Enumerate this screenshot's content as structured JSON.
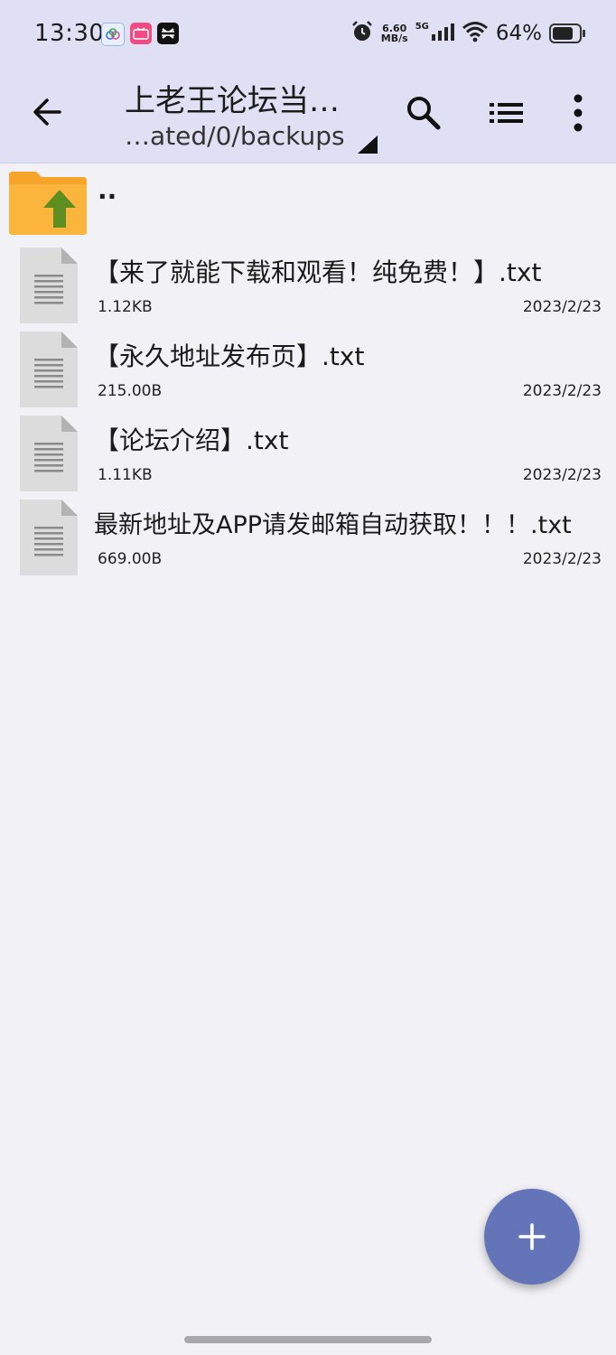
{
  "status_bar": {
    "time": "13:30",
    "net_speed_value": "6.60",
    "net_speed_unit": "MB/s",
    "signal_label": "5G",
    "battery": "64%"
  },
  "toolbar": {
    "title": "上老王论坛当…",
    "path": "…ated/0/backups"
  },
  "parent_dir": "..",
  "files": [
    {
      "name": "【来了就能下载和观看！纯免费！】.txt",
      "size": "1.12KB",
      "date": "2023/2/23"
    },
    {
      "name": "【永久地址发布页】.txt",
      "size": "215.00B",
      "date": "2023/2/23"
    },
    {
      "name": "【论坛介绍】.txt",
      "size": "1.11KB",
      "date": "2023/2/23"
    },
    {
      "name": "最新地址及APP请发邮箱自动获取！！！.txt",
      "size": "669.00B",
      "date": "2023/2/23"
    }
  ],
  "colors": {
    "header_bg": "#dfe0f4",
    "body_bg": "#f2f1f6",
    "fab": "#6474b8",
    "folder": "#f7a42a",
    "folder_arrow": "#5e8e1f"
  }
}
